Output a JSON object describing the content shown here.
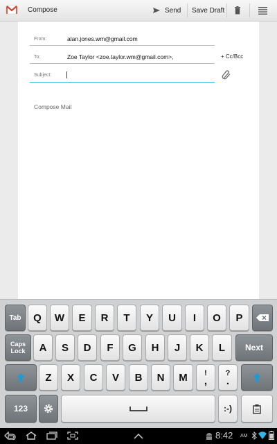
{
  "actionbar": {
    "title": "Compose",
    "send_label": "Send",
    "save_draft_label": "Save Draft"
  },
  "form": {
    "from_label": "From:",
    "from_value": "alan.jones.wm@gmail.com",
    "to_label": "To:",
    "to_value": "Zoe Taylor <zoe.taylor.wm@gmail.com>,",
    "cc_bcc_label": "+ Cc/Bcc",
    "subject_label": "Subject:",
    "subject_value": "",
    "body_placeholder": "Compose Mail"
  },
  "keyboard": {
    "row1": [
      "Tab",
      "Q",
      "W",
      "E",
      "R",
      "T",
      "Y",
      "U",
      "I",
      "O",
      "P"
    ],
    "row2": [
      "A",
      "S",
      "D",
      "F",
      "G",
      "H",
      "J",
      "K",
      "L"
    ],
    "caps_label_1": "Caps",
    "caps_label_2": "Lock",
    "next_label": "Next",
    "row3": [
      "Z",
      "X",
      "C",
      "V",
      "B",
      "N",
      "M"
    ],
    "excl_top": "!",
    "excl_bottom": ",",
    "quest_top": "?",
    "quest_bottom": ".",
    "num_label": "123",
    "smiley_label": ":-)"
  },
  "statusbar": {
    "time": "8:42",
    "ampm": "AM"
  },
  "colors": {
    "accent_blue": "#1e9bd7",
    "gmail_red": "#d4422f"
  }
}
